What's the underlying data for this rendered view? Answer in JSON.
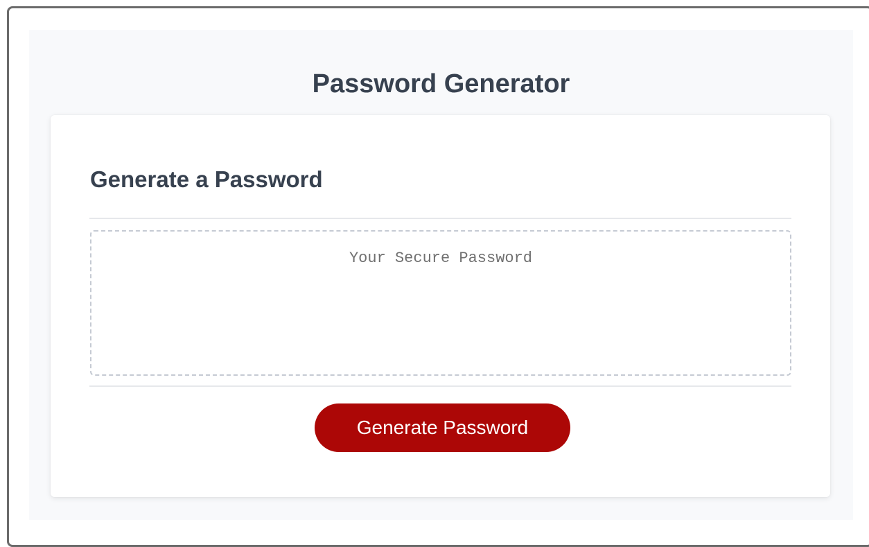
{
  "header": {
    "title": "Password Generator"
  },
  "card": {
    "title": "Generate a Password",
    "password_output": {
      "value": "",
      "placeholder": "Your Secure Password"
    },
    "generate_button_label": "Generate Password"
  },
  "colors": {
    "page_background": "#f8f9fb",
    "title_text": "#37414f",
    "button_background": "#ac0706",
    "button_text": "#ffffff",
    "dashed_border": "#c5cad3"
  }
}
